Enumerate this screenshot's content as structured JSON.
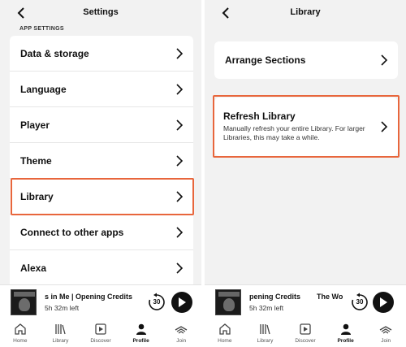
{
  "left": {
    "title": "Settings",
    "section_label": "APP SETTINGS",
    "rows": [
      {
        "label": "Data & storage"
      },
      {
        "label": "Language"
      },
      {
        "label": "Player"
      },
      {
        "label": "Theme"
      },
      {
        "label": "Library"
      },
      {
        "label": "Connect to other apps"
      },
      {
        "label": "Alexa"
      }
    ],
    "highlighted_row": "Library",
    "player": {
      "title": "s in Me | Opening Credits",
      "remaining": "5h 32m left",
      "skip_seconds": "30"
    }
  },
  "right": {
    "title": "Library",
    "arrange_label": "Arrange Sections",
    "refresh_label": "Refresh Library",
    "refresh_desc": "Manually refresh your entire Library. For larger Libraries, this may take a while.",
    "player": {
      "title": "pening Credits        The Wo",
      "remaining": "5h 32m left",
      "skip_seconds": "30"
    }
  },
  "tabs": [
    {
      "label": "Home",
      "icon": "home-icon"
    },
    {
      "label": "Library",
      "icon": "library-icon"
    },
    {
      "label": "Discover",
      "icon": "discover-icon"
    },
    {
      "label": "Profile",
      "icon": "profile-icon",
      "active": true
    },
    {
      "label": "Join",
      "icon": "join-icon"
    }
  ],
  "colors": {
    "highlight": "#e8663c",
    "background": "#f2f2f2"
  }
}
